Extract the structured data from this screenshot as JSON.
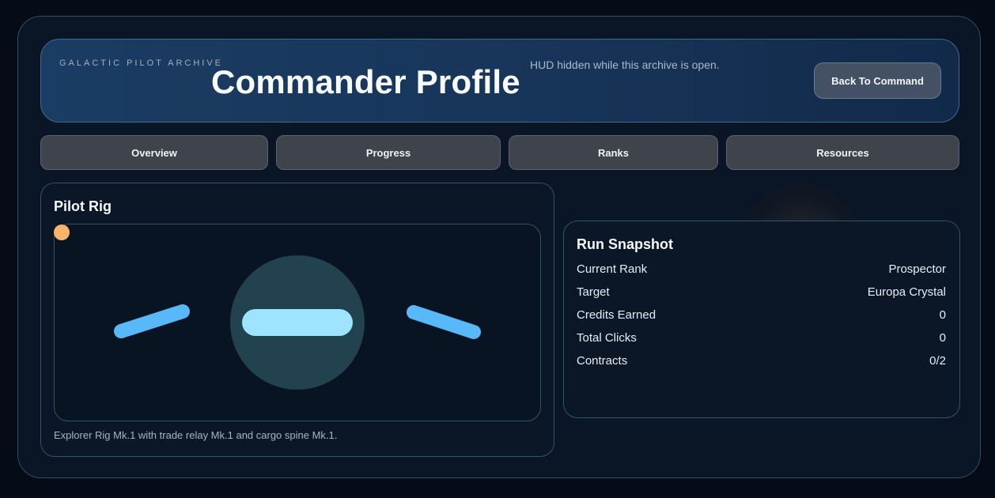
{
  "header": {
    "eyebrow": "GALACTIC PILOT ARCHIVE",
    "title": "Commander Profile",
    "hud_note": "HUD hidden while this archive is open.",
    "back_label": "Back To Command"
  },
  "tabs": [
    {
      "label": "Overview"
    },
    {
      "label": "Progress"
    },
    {
      "label": "Ranks"
    },
    {
      "label": "Resources"
    }
  ],
  "rig": {
    "title": "Pilot Rig",
    "caption": "Explorer Rig Mk.1 with trade relay Mk.1 and cargo spine Mk.1."
  },
  "snapshot": {
    "title": "Run Snapshot",
    "rows": [
      {
        "label": "Current Rank",
        "value": "Prospector"
      },
      {
        "label": "Target",
        "value": "Europa Crystal"
      },
      {
        "label": "Credits Earned",
        "value": "0"
      },
      {
        "label": "Total Clicks",
        "value": "0"
      },
      {
        "label": "Contracts",
        "value": "0/2"
      }
    ]
  },
  "colors": {
    "accent": "#59b8f7",
    "cockpit_bar": "#9fe4ff",
    "status_dot": "#f7b46a",
    "hull": "#22424f"
  },
  "icons": {
    "status": "status-dot-icon",
    "wing_left": "left-wing-icon",
    "wing_right": "right-wing-icon"
  }
}
